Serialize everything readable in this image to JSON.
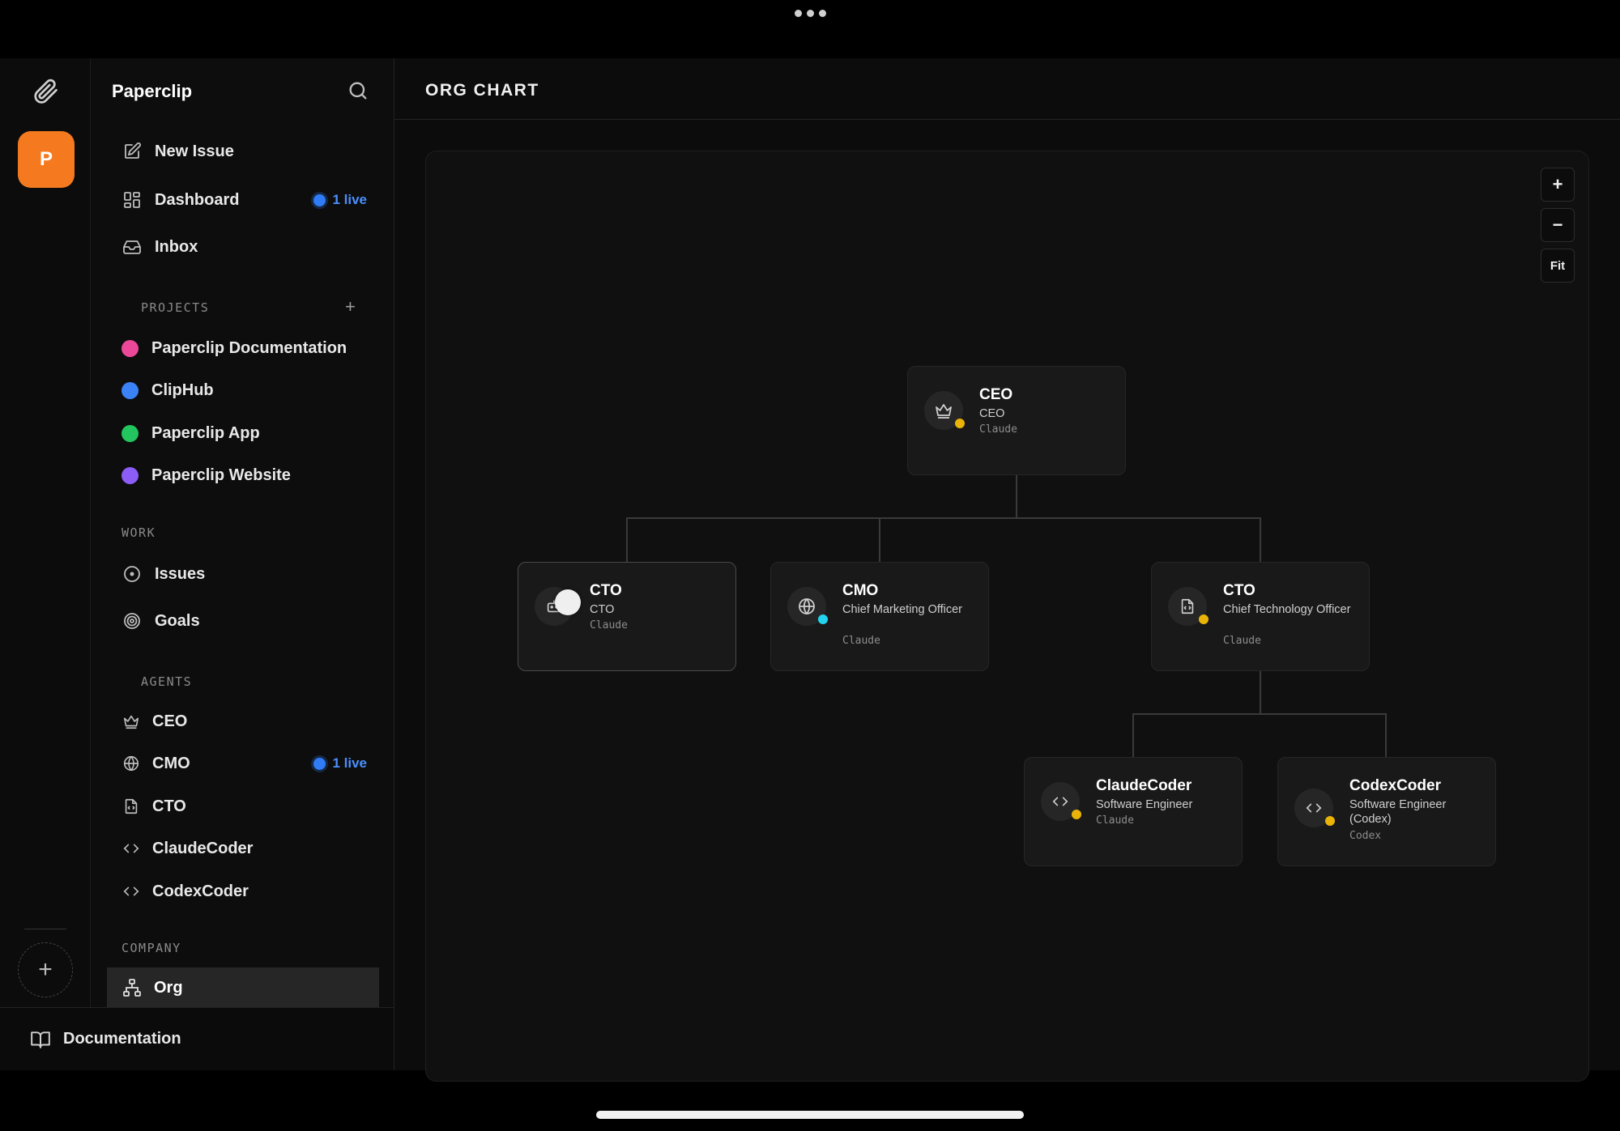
{
  "app": {
    "name": "Paperclip",
    "company_initial": "P"
  },
  "sidebar": {
    "nav": [
      {
        "label": "New Issue",
        "icon": "edit-icon"
      },
      {
        "label": "Dashboard",
        "icon": "dashboard-icon",
        "badge": "1 live"
      },
      {
        "label": "Inbox",
        "icon": "inbox-icon"
      }
    ],
    "projects_heading": "PROJECTS",
    "projects": [
      {
        "label": "Paperclip Documentation",
        "color": "#ec4899"
      },
      {
        "label": "ClipHub",
        "color": "#3b82f6"
      },
      {
        "label": "Paperclip App",
        "color": "#22c55e"
      },
      {
        "label": "Paperclip Website",
        "color": "#8b5cf6"
      }
    ],
    "work_heading": "WORK",
    "work": [
      {
        "label": "Issues",
        "icon": "circle-dot-icon"
      },
      {
        "label": "Goals",
        "icon": "target-icon"
      }
    ],
    "agents_heading": "AGENTS",
    "agents": [
      {
        "label": "CEO",
        "icon": "crown-icon"
      },
      {
        "label": "CMO",
        "icon": "globe-icon",
        "badge": "1 live"
      },
      {
        "label": "CTO",
        "icon": "file-code-icon"
      },
      {
        "label": "ClaudeCoder",
        "icon": "code-icon"
      },
      {
        "label": "CodexCoder",
        "icon": "code-icon"
      }
    ],
    "company_heading": "COMPANY",
    "org_label": "Org",
    "documentation_label": "Documentation"
  },
  "main": {
    "title": "ORG CHART",
    "zoom": {
      "in": "+",
      "out": "−",
      "fit": "Fit"
    }
  },
  "org": {
    "ceo": {
      "name": "CEO",
      "role": "CEO",
      "model": "Claude",
      "status_color": "#eab308"
    },
    "cto_a": {
      "name": "CTO",
      "role": "CTO",
      "model": "Claude"
    },
    "cmo": {
      "name": "CMO",
      "role": "Chief Marketing Officer",
      "model": "Claude",
      "status_color": "#22d3ee"
    },
    "cto_b": {
      "name": "CTO",
      "role": "Chief Technology Officer",
      "model": "Claude",
      "status_color": "#eab308"
    },
    "claudecoder": {
      "name": "ClaudeCoder",
      "role": "Software Engineer",
      "model": "Claude",
      "status_color": "#eab308"
    },
    "codexcoder": {
      "name": "CodexCoder",
      "role": "Software Engineer (Codex)",
      "model": "Codex",
      "status_color": "#eab308"
    }
  }
}
